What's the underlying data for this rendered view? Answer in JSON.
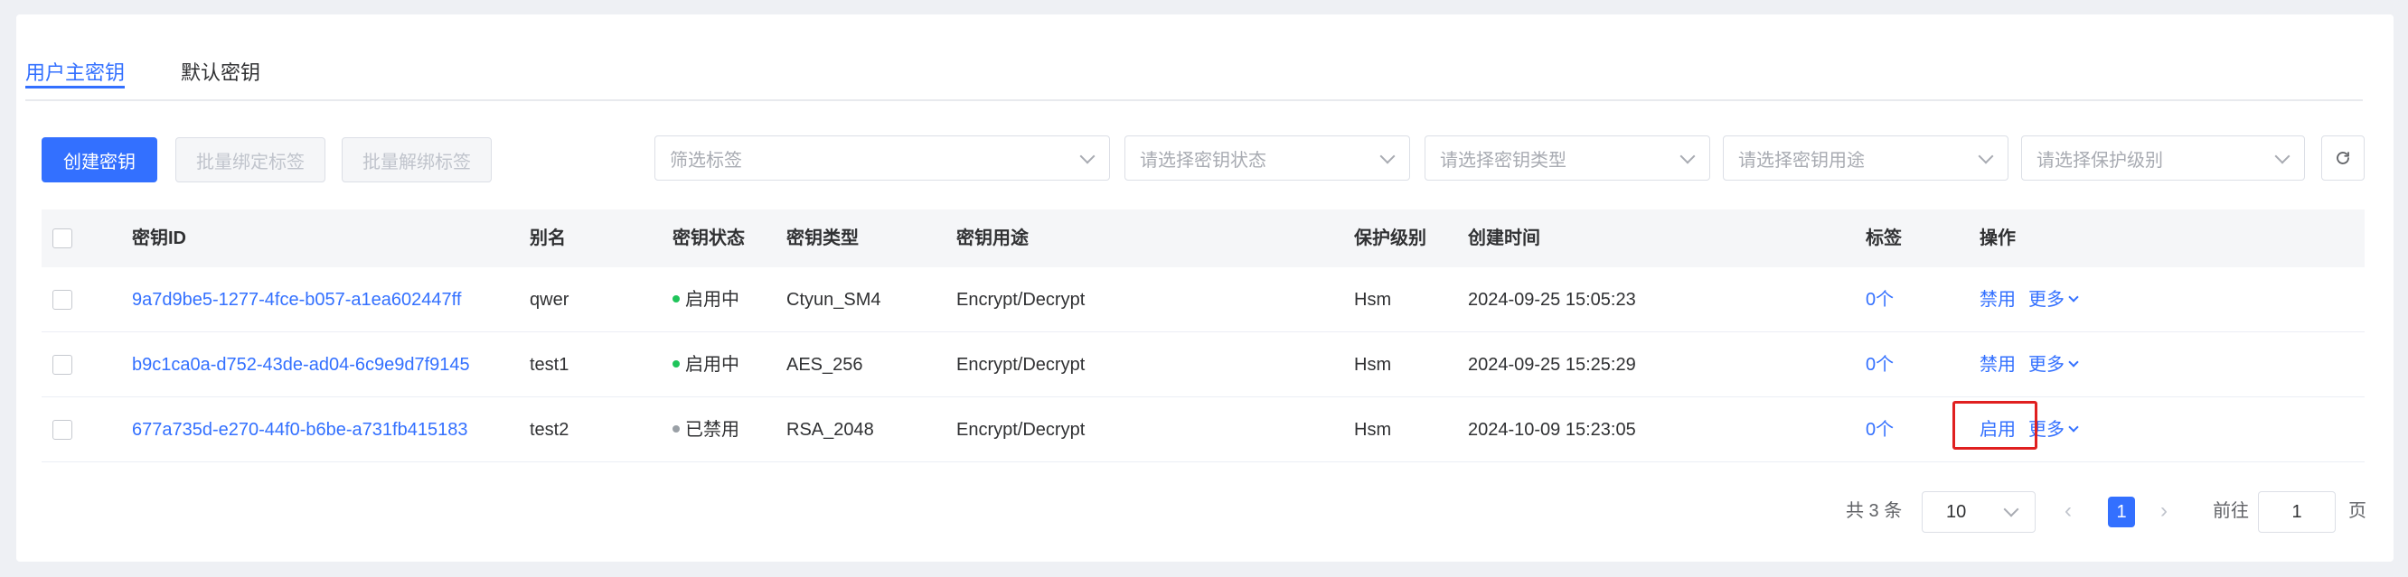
{
  "tabs": [
    {
      "label": "用户主密钥",
      "active": true
    },
    {
      "label": "默认密钥",
      "active": false
    }
  ],
  "toolbar": {
    "create_label": "创建密钥",
    "bind_label": "批量绑定标签",
    "unbind_label": "批量解绑标签",
    "filters": [
      {
        "placeholder": "筛选标签"
      },
      {
        "placeholder": "请选择密钥状态"
      },
      {
        "placeholder": "请选择密钥类型"
      },
      {
        "placeholder": "请选择密钥用途"
      },
      {
        "placeholder": "请选择保护级别"
      }
    ]
  },
  "table": {
    "headers": {
      "key_id": "密钥ID",
      "alias": "别名",
      "status": "密钥状态",
      "type": "密钥类型",
      "usage": "密钥用途",
      "protection": "保护级别",
      "created": "创建时间",
      "tags": "标签",
      "actions": "操作"
    },
    "rows": [
      {
        "key_id": "9a7d9be5-1277-4fce-b057-a1ea602447ff",
        "alias": "qwer",
        "status": "启用中",
        "status_color": "#1fc45a",
        "type": "Ctyun_SM4",
        "usage": "Encrypt/Decrypt",
        "protection": "Hsm",
        "created": "2024-09-25 15:05:23",
        "tags": "0个",
        "action": "禁用",
        "more": "更多"
      },
      {
        "key_id": "b9c1ca0a-d752-43de-ad04-6c9e9d7f9145",
        "alias": "test1",
        "status": "启用中",
        "status_color": "#1fc45a",
        "type": "AES_256",
        "usage": "Encrypt/Decrypt",
        "protection": "Hsm",
        "created": "2024-09-25 15:25:29",
        "tags": "0个",
        "action": "禁用",
        "more": "更多"
      },
      {
        "key_id": "677a735d-e270-44f0-b6be-a731fb415183",
        "alias": "test2",
        "status": "已禁用",
        "status_color": "#9aa0a6",
        "type": "RSA_2048",
        "usage": "Encrypt/Decrypt",
        "protection": "Hsm",
        "created": "2024-10-09 15:23:05",
        "tags": "0个",
        "action": "启用",
        "more": "更多"
      }
    ]
  },
  "pagination": {
    "total": "共 3 条",
    "page_size": "10",
    "current_page": "1",
    "goto_prefix": "前往",
    "goto_value": "1",
    "goto_suffix": "页"
  },
  "colors": {
    "accent": "#3370ff",
    "highlight": "#e02020"
  }
}
